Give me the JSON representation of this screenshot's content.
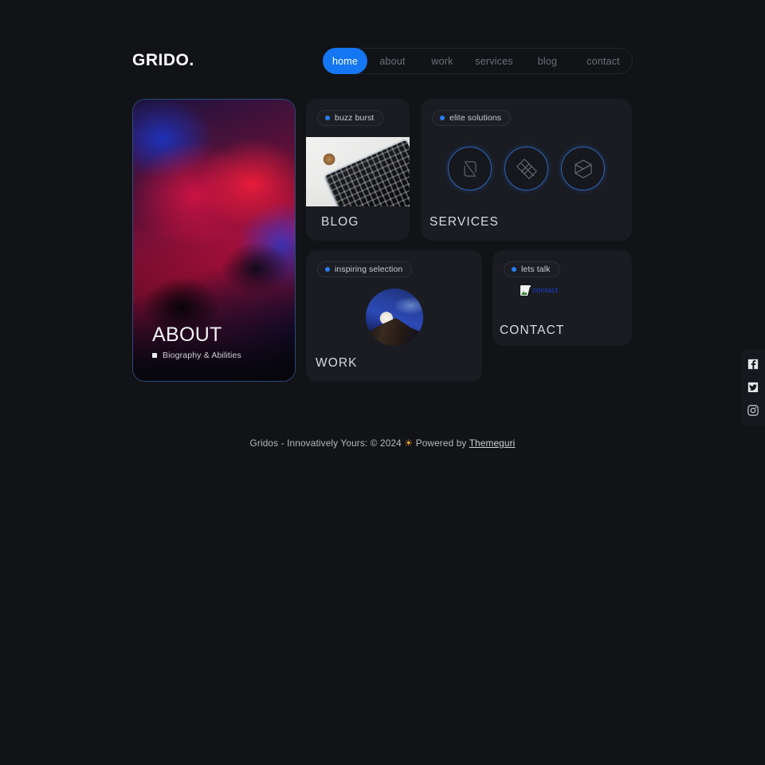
{
  "site": {
    "logo": "GRIDO.",
    "background_color": "#121317",
    "accent_color": "#1476f2",
    "card_color": "#1a1c22"
  },
  "nav": {
    "items": [
      {
        "label": "home",
        "active": true
      },
      {
        "label": "about",
        "active": false
      },
      {
        "label": "work",
        "active": false
      },
      {
        "label": "services",
        "active": false
      },
      {
        "label": "blog",
        "active": false
      },
      {
        "label": "contact",
        "active": false
      }
    ]
  },
  "cards": {
    "about": {
      "title": "ABOUT",
      "subtitle": "Biography & Abilities",
      "image_alt": "neon-portrait-photo"
    },
    "blog": {
      "badge": "buzz burst",
      "title": "BLOG",
      "image_alt": "coffee-cup-and-keyboard-photo"
    },
    "services": {
      "badge": "elite solutions",
      "title": "SERVICES",
      "icons": [
        "n-monogram-icon",
        "interlocking-diamonds-icon",
        "cube-hexagon-icon"
      ]
    },
    "work": {
      "badge": "inspiring selection",
      "title": "WORK",
      "image_alt": "moon-over-mountains-thumbnail"
    },
    "contact": {
      "badge": "lets talk",
      "title": "CONTACT",
      "broken_image_alt": "contact"
    }
  },
  "footer": {
    "text_before": "Gridos  -  Innovatively Yours: © 2024",
    "sun": "☀",
    "powered_by": "Powered by",
    "link": "Themeguri"
  },
  "social": {
    "items": [
      {
        "name": "facebook-icon"
      },
      {
        "name": "twitter-icon"
      },
      {
        "name": "instagram-icon"
      }
    ]
  }
}
